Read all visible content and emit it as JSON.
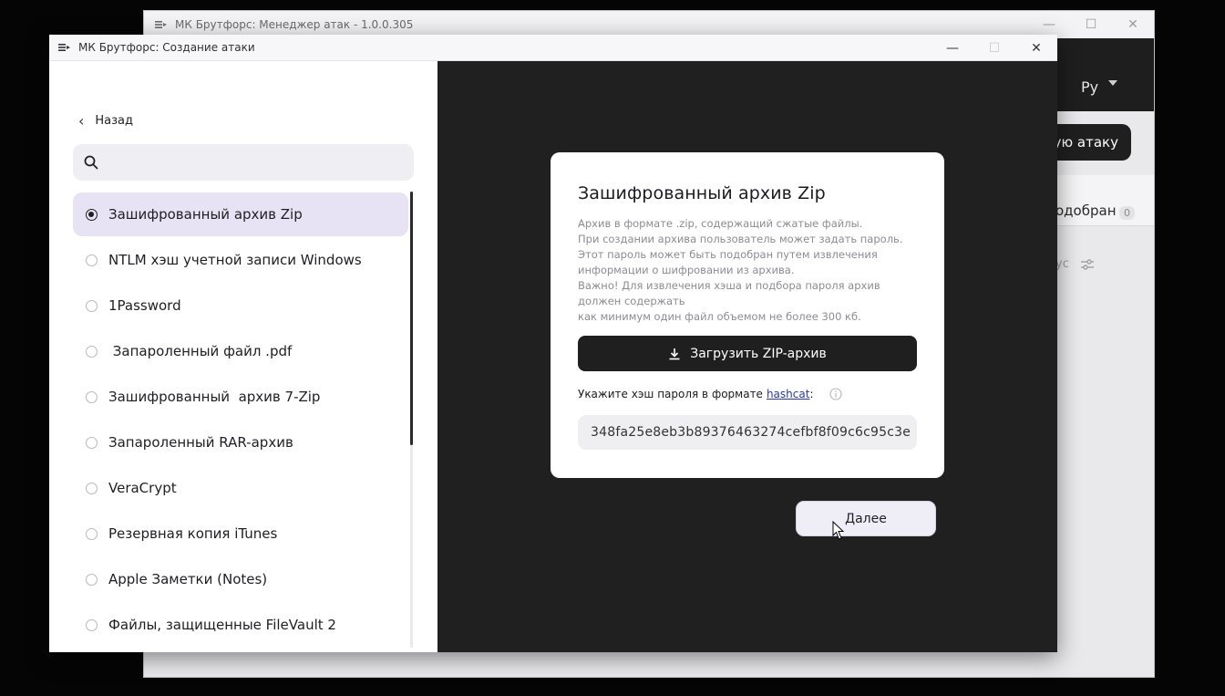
{
  "background_window": {
    "title": "МК Брутфорс: Менеджер атак - 1.0.0.305",
    "language": "Ру",
    "new_attack_button": "ую атаку",
    "found_tab": "одобран",
    "found_count": "0",
    "status_label": "ус",
    "controls": {
      "minimize": "—",
      "maximize": "☐",
      "close": "✕"
    }
  },
  "dialog": {
    "title": "МК Брутфорс: Создание атаки",
    "controls": {
      "minimize": "—",
      "maximize": "☐",
      "close": "✕"
    },
    "back_label": "Назад",
    "search": {
      "placeholder": "",
      "value": ""
    },
    "attack_types": [
      {
        "label": "Зашифрованный архив Zip",
        "selected": true
      },
      {
        "label": "NTLM хэш учетной записи Windows",
        "selected": false
      },
      {
        "label": "1Password",
        "selected": false
      },
      {
        "label": " Запароленный файл .pdf",
        "selected": false
      },
      {
        "label": "Зашифрованный  архив 7-Zip",
        "selected": false
      },
      {
        "label": "Запароленный RAR-архив",
        "selected": false
      },
      {
        "label": "VeraCrypt",
        "selected": false
      },
      {
        "label": "Резервная копия iTunes",
        "selected": false
      },
      {
        "label": "Apple Заметки (Notes)",
        "selected": false
      },
      {
        "label": "Файлы, защищенные FileVault 2",
        "selected": false
      }
    ],
    "card": {
      "title": "Зашифрованный архив Zip",
      "description_lines": [
        "Архив в формате .zip, содержащий сжатые файлы.",
        "При создании архива пользователь может задать пароль.",
        "Этот пароль может быть подобран путем извлечения",
        "информации о шифровании из архива.",
        "Важно! Для извлечения хэша и подбора пароля архив",
        "должен содержать",
        "как минимум один файл объемом не более 300 кб."
      ],
      "upload_button": "Загрузить ZIP-архив",
      "hash_prompt": "Укажите хэш пароля в формате",
      "hash_link": "hashcat",
      "hash_colon": ":",
      "hash_value": "348fa25e8eb3b89376463274cefbf8f09c6c95c3e"
    },
    "next_button": "Далее"
  },
  "colors": {
    "accent_selected": "#e7e3f4",
    "dark_panel": "#202020",
    "button_dark": "#1f1f1f",
    "link": "#2a3aa0"
  }
}
